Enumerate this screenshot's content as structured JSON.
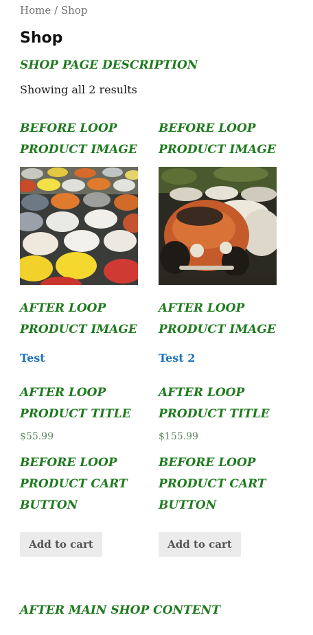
{
  "breadcrumb": {
    "home": "Home",
    "separator": " / ",
    "current": "Shop"
  },
  "page": {
    "title": "Shop",
    "description": "SHOP PAGE DESCRIPTION",
    "result_count": "Showing all 2 results",
    "after_main": "AFTER MAIN SHOP CONTENT"
  },
  "hooks": {
    "before_image": [
      "BEFORE LOOP",
      "PRODUCT IMAGE"
    ],
    "after_image": [
      "AFTER LOOP",
      "PRODUCT IMAGE"
    ],
    "after_title": [
      "AFTER LOOP",
      "PRODUCT TITLE"
    ],
    "before_cart": [
      "BEFORE LOOP",
      "PRODUCT CART",
      "BUTTON"
    ]
  },
  "products": [
    {
      "title": "Test",
      "price": "$55.99",
      "button": "Add to cart",
      "image": "yellow-beetles-photo"
    },
    {
      "title": "Test 2",
      "price": "$155.99",
      "button": "Add to cart",
      "image": "orange-beetle-photo"
    }
  ],
  "colors": {
    "hook": "#1f7a1f",
    "link": "#1e73be",
    "price": "#5d8a5d",
    "button_bg": "#ebebeb"
  }
}
